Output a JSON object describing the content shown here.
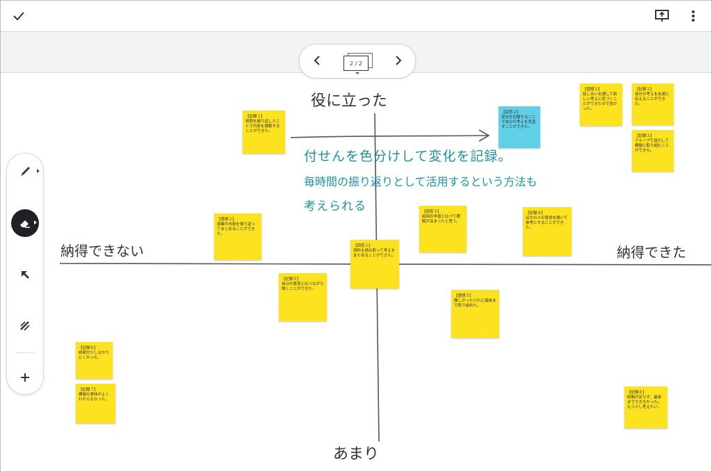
{
  "app": {
    "pager": {
      "page_indicator": "2 / 2"
    }
  },
  "axes": {
    "top": "役に立った",
    "bottom": "あまり",
    "left": "納得できない",
    "right": "納得できた"
  },
  "annotation": {
    "line1": "付せんを色分けして変化を記録。",
    "line2": "毎時間の振り返りとして活用するという方法も",
    "line3": "考えられる"
  },
  "toolbar": {
    "tools": [
      {
        "name": "pen-tool",
        "icon": "pen-icon"
      },
      {
        "name": "eraser-tool",
        "icon": "eraser-icon"
      },
      {
        "name": "select-tool",
        "icon": "arrow-cursor-icon"
      },
      {
        "name": "laser-tool",
        "icon": "laser-icon"
      },
      {
        "name": "add-tool",
        "icon": "plus-icon"
      }
    ]
  },
  "colors": {
    "sticky_yellow": "#fde31f",
    "sticky_blue": "#5fd0e8",
    "handwriting_blue": "#1b93a3"
  },
  "sticky_notes": [
    {
      "id": "n1",
      "color": "yellow",
      "tag": "【記録１】",
      "body": "質問を繰り返したことで内容を理解することができた。"
    },
    {
      "id": "n2",
      "color": "blue",
      "tag": "【回答２】",
      "body": "変化を記録することで自分の考えを見直すことができた。"
    },
    {
      "id": "n3",
      "color": "yellow",
      "tag": "【感想１】",
      "body": "話し合いを通して新しい考えに気づくことができたので良かった。"
    },
    {
      "id": "n4",
      "color": "yellow",
      "tag": "【記録２】",
      "body": "自分の考えを友達に伝えることができた。"
    },
    {
      "id": "n5",
      "color": "yellow",
      "tag": "【記録３】",
      "body": "グループで協力して課題に取り組むことができた。"
    },
    {
      "id": "n6",
      "color": "yellow",
      "tag": "【感想２】",
      "body": "授業の内容を振り返ってまとめることができた。"
    },
    {
      "id": "n7",
      "color": "yellow",
      "tag": "【回答３】",
      "body": "前回の学習と比べて理解が深まったと思う。"
    },
    {
      "id": "n8",
      "color": "yellow",
      "tag": "【記録４】",
      "body": "ほかの人の意見を聞いて参考にすることができた。"
    },
    {
      "id": "n9",
      "color": "yellow",
      "tag": "【回答１】",
      "body": "資料を読み取って考えをまとめることができた。"
    },
    {
      "id": "n10",
      "color": "yellow",
      "tag": "【記録５】",
      "body": "自分の意見と比べながら聞くことができた。"
    },
    {
      "id": "n11",
      "color": "yellow",
      "tag": "【感想３】",
      "body": "難しかったけれど最後まで取り組めた。"
    },
    {
      "id": "n12",
      "color": "yellow",
      "tag": "【記録６】",
      "body": "説明が少し分かりにくかった。"
    },
    {
      "id": "n13",
      "color": "yellow",
      "tag": "【記録７】",
      "body": "課題の意味がよくわからなかった。"
    },
    {
      "id": "n14",
      "color": "yellow",
      "tag": "【記録８】",
      "body": "時間が足りず、最後までできなかった。もう少し考えたい。"
    },
    {
      "id": "n15",
      "color": "yellow",
      "tag": "【感想４】",
      "body": "次はもっと自分の考えを書けるようにしたい。"
    }
  ]
}
